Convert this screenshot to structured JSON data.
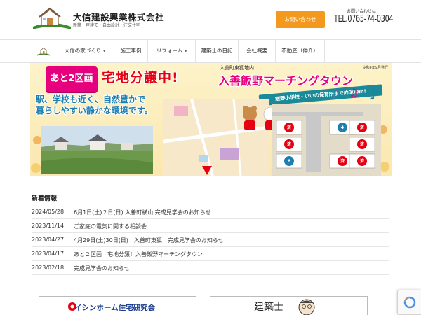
{
  "header": {
    "company_name": "大信建設興業株式会社",
    "tagline": "新築一戸建て・自由設計・注文住宅",
    "contact_button": "お問い合わせ",
    "phone_label": "お問い合わせは",
    "phone": "TEL.0765-74-0304"
  },
  "nav": {
    "items": [
      {
        "label": "大信の家づくり",
        "has_dropdown": true
      },
      {
        "label": "施工事例",
        "has_dropdown": false
      },
      {
        "label": "リフォーム",
        "has_dropdown": true
      },
      {
        "label": "建築士の日記",
        "has_dropdown": false
      },
      {
        "label": "会社概要",
        "has_dropdown": false
      },
      {
        "label": "不動産（仲介）",
        "has_dropdown": false
      }
    ],
    "dropdown_icon": "chevron-down-icon",
    "home_icon": "home-logo-icon"
  },
  "hero": {
    "badge": "あと2区画",
    "title": "宅地分譲中!",
    "area": "入善町東狐地内",
    "town": "入善飯野マーチングタウン",
    "date": "令和4年9月発行",
    "school_note": "飯野小学校・いいの保育所まで約300m!",
    "copy_line1": "駅、学校も近く、自然豊かで",
    "copy_line2": "暮らしやすい静かな環境です。",
    "lots": [
      {
        "label": "済"
      },
      {
        "label": "4"
      },
      {
        "label": "済"
      },
      {
        "label": "済"
      },
      {
        "label": "済"
      },
      {
        "label": "6"
      },
      {
        "label": "済"
      },
      {
        "label": "済"
      }
    ]
  },
  "news": {
    "heading": "新着情報",
    "items": [
      {
        "date": "2024/05/28",
        "text": "6月1日(土)２日(日) 入善町横山 完成見学会のお知らせ"
      },
      {
        "date": "2023/11/14",
        "text": "ご家庭の電気に関する相談会"
      },
      {
        "date": "2023/04/27",
        "text": "4月29日(土)30日(日)　入善町東狐　完成見学会のお知らせ"
      },
      {
        "date": "2023/04/17",
        "text": "あと２区画　宅地分譲！入善飯野マーチングタウン"
      },
      {
        "date": "2023/02/18",
        "text": "完成見学会のお知らせ"
      }
    ]
  },
  "banners": {
    "ishin": "イシンホーム住宅研究会",
    "diary": "建築士"
  },
  "colors": {
    "accent_orange": "#f39a1e",
    "hero_pink": "#e6007e",
    "hero_red": "#e60012",
    "brand_green": "#3c8d2f"
  }
}
